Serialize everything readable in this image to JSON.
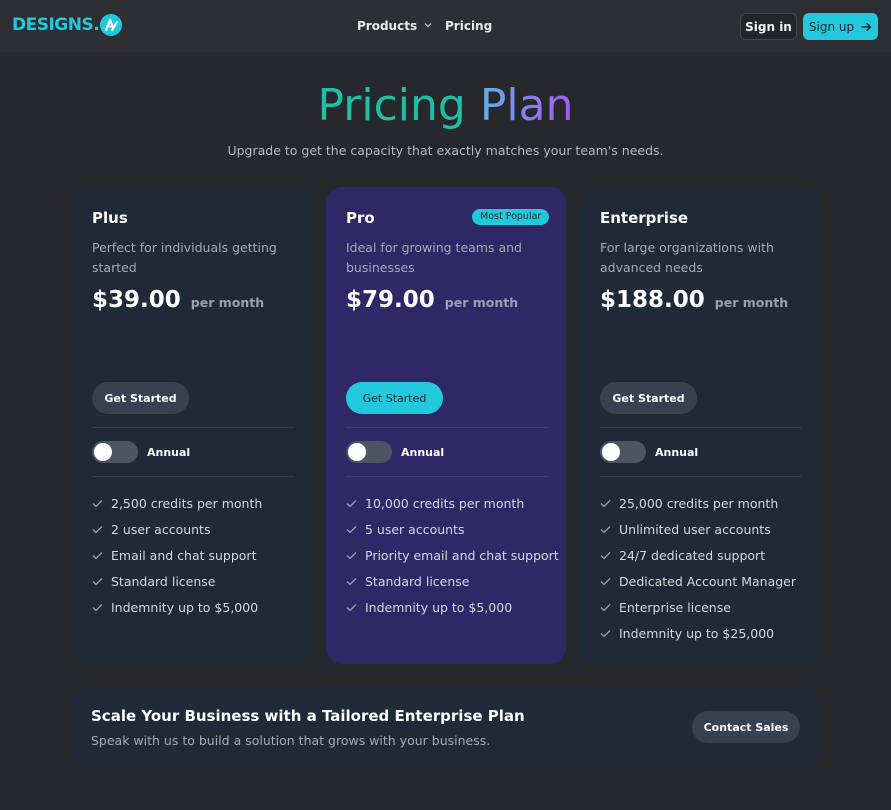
{
  "nav": {
    "logo_text": "DESIGNS.",
    "links": [
      {
        "label": "Products"
      },
      {
        "label": "Pricing"
      }
    ],
    "signin_label": "Sign in",
    "signup_label": "Sign up"
  },
  "hero": {
    "title_word1": "Pricing",
    "title_word2": "Plan",
    "subtitle": "Upgrade to get the capacity that exactly matches your team's needs."
  },
  "plans": [
    {
      "name": "Plus",
      "description": "Perfect for individuals getting started",
      "price": "$39.00",
      "period": "per month",
      "cta": "Get Started",
      "toggle_label": "Annual",
      "features": [
        "2,500 credits per month",
        "2 user accounts",
        "Email and chat support",
        "Standard license",
        "Indemnity up to $5,000"
      ]
    },
    {
      "name": "Pro",
      "badge": "Most Popular",
      "description": "Ideal for growing teams and businesses",
      "price": "$79.00",
      "period": "per month",
      "cta": "Get Started",
      "toggle_label": "Annual",
      "features": [
        "10,000 credits per month",
        "5 user accounts",
        "Priority email and chat support",
        "Standard license",
        "Indemnity up to $5,000"
      ]
    },
    {
      "name": "Enterprise",
      "description": "For large organizations with advanced needs",
      "price": "$188.00",
      "period": "per month",
      "cta": "Get Started",
      "toggle_label": "Annual",
      "features": [
        "25,000 credits per month",
        "Unlimited user accounts",
        "24/7 dedicated support",
        "Dedicated Account Manager",
        "Enterprise license",
        "Indemnity up to $25,000"
      ]
    }
  ],
  "cta_banner": {
    "title": "Scale Your Business with a Tailored Enterprise Plan",
    "subtitle": "Speak with us to build a solution that grows with your business.",
    "button": "Contact Sales"
  },
  "colors": {
    "accent": "#22c9dd",
    "card": "#1f2937",
    "pro_card": "#2e2866"
  }
}
